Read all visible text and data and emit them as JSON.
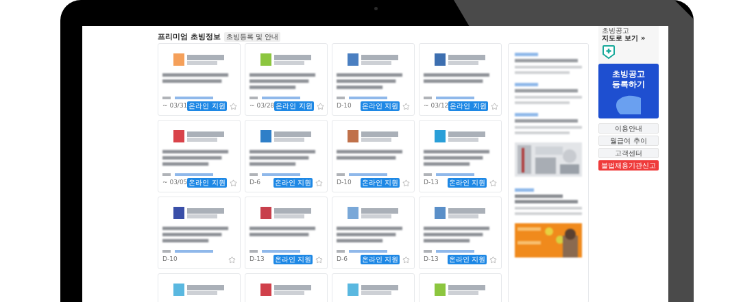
{
  "section": {
    "title": "프리미엄 초빙정보",
    "guide_button": "초빙등록 및 안내"
  },
  "cards": [
    {
      "deadline": "~ 03/31",
      "badge": "온라인 지원",
      "color": "#f5a05a"
    },
    {
      "deadline": "~ 03/28",
      "badge": "온라인 지원",
      "color": "#8cc63f"
    },
    {
      "deadline": "D-10",
      "badge": "온라인 지원",
      "color": "#4a7fc1"
    },
    {
      "deadline": "~ 03/12",
      "badge": "온라인 지원",
      "color": "#3d6fb0"
    },
    {
      "deadline": "~ 03/05",
      "badge": "온라인 지원",
      "color": "#d9434a"
    },
    {
      "deadline": "D-6",
      "badge": "온라인 지원",
      "color": "#2f7fc8"
    },
    {
      "deadline": "D-10",
      "badge": "온라인 지원",
      "color": "#c0714a"
    },
    {
      "deadline": "D-13",
      "badge": "온라인 지원",
      "color": "#2a9fd8"
    },
    {
      "deadline": "D-10",
      "color": "#3a4fa8"
    },
    {
      "deadline": "D-13",
      "badge": "온라인 지원",
      "color": "#c8404c"
    },
    {
      "deadline": "D-6",
      "badge": "온라인 지원",
      "color": "#7aa8d8"
    },
    {
      "deadline": "D-13",
      "badge": "온라인 지원",
      "color": "#5a8fc8"
    }
  ],
  "partial_cards": [
    {
      "color": "#5ab8e0"
    },
    {
      "color": "#d0404a"
    },
    {
      "color": "#5ab8e0"
    },
    {
      "color": "#8cc63f"
    }
  ],
  "sidebar": {
    "map_caption": "초빙공고",
    "map_link": "지도로 보기 »",
    "register_banner": [
      "초빙공고",
      "등록하기"
    ],
    "links": [
      {
        "label": "이용안내",
        "kind": "plain"
      },
      {
        "label": "월급여 추이",
        "kind": "plain"
      },
      {
        "label": "고객센터",
        "kind": "plain"
      },
      {
        "label": "불법채용기관신고",
        "kind": "alert"
      }
    ]
  }
}
